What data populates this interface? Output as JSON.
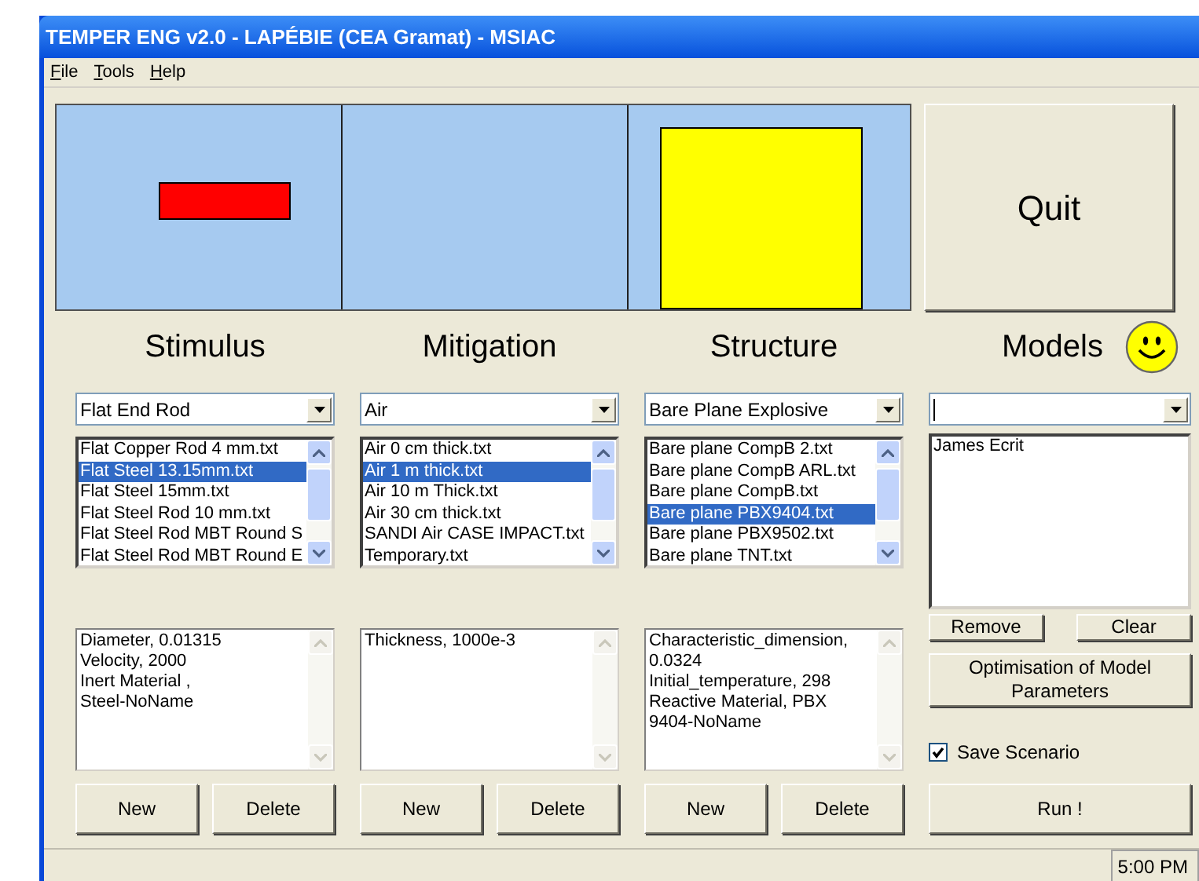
{
  "window": {
    "title": "TEMPER ENG v2.0 - LAPÉBIE (CEA Gramat) - MSIAC"
  },
  "menu": [
    {
      "label": "File"
    },
    {
      "label": "Tools"
    },
    {
      "label": "Help"
    }
  ],
  "quit_button": "Quit",
  "columns": [
    {
      "heading": "Stimulus",
      "dropdown": "Flat End Rod",
      "list": [
        {
          "label": "Flat Copper Rod 4 mm.txt",
          "selected": false
        },
        {
          "label": "Flat Steel 13.15mm.txt",
          "selected": true
        },
        {
          "label": "Flat Steel 15mm.txt",
          "selected": false
        },
        {
          "label": "Flat Steel Rod 10 mm.txt",
          "selected": false
        },
        {
          "label": "Flat Steel Rod MBT Round S",
          "selected": false
        },
        {
          "label": "Flat Steel Rod MBT Round E",
          "selected": false
        }
      ],
      "parameters": [
        "Diameter, 0.01315",
        "Velocity, 2000",
        "Inert Material ,",
        "Steel-NoName"
      ],
      "buttons": [
        "New",
        "Delete"
      ]
    },
    {
      "heading": "Mitigation",
      "dropdown": "Air",
      "list": [
        {
          "label": "Air 0 cm thick.txt",
          "selected": false
        },
        {
          "label": "Air 1 m thick.txt",
          "selected": true
        },
        {
          "label": "Air 10 m Thick.txt",
          "selected": false
        },
        {
          "label": "Air 30 cm thick.txt",
          "selected": false
        },
        {
          "label": "SANDI Air CASE IMPACT.txt",
          "selected": false
        },
        {
          "label": "Temporary.txt",
          "selected": false
        }
      ],
      "parameters": [
        "Thickness, 1000e-3"
      ],
      "buttons": [
        "New",
        "Delete"
      ]
    },
    {
      "heading": "Structure",
      "dropdown": "Bare Plane Explosive",
      "list": [
        {
          "label": "Bare plane CompB 2.txt",
          "selected": false
        },
        {
          "label": "Bare plane CompB ARL.txt",
          "selected": false
        },
        {
          "label": "Bare plane CompB.txt",
          "selected": false
        },
        {
          "label": "Bare plane PBX9404.txt",
          "selected": true
        },
        {
          "label": "Bare plane PBX9502.txt",
          "selected": false
        },
        {
          "label": "Bare plane TNT.txt",
          "selected": false
        }
      ],
      "parameters": [
        "Characteristic_dimension,",
        "0.0324",
        "Initial_temperature, 298",
        "Reactive Material, PBX",
        "9404-NoName"
      ],
      "buttons": [
        "New",
        "Delete"
      ]
    }
  ],
  "models": {
    "heading": "Models",
    "list": [
      {
        "label": "James Ecrit",
        "selected": false
      }
    ],
    "buttons": [
      "Remove",
      "Clear"
    ],
    "optimisation_button": "Optimisation of Model Parameters",
    "save_scenario": {
      "label": "Save Scenario",
      "checked": true
    },
    "run_button": "Run !"
  },
  "status_bar": {
    "time": "5:00 PM"
  }
}
